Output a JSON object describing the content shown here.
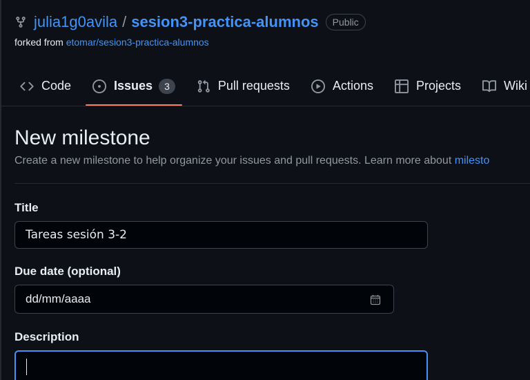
{
  "repo": {
    "owner": "julia1g0avila",
    "separator": "/",
    "name": "sesion3-practica-alumnos",
    "visibility": "Public",
    "forked_prefix": "forked from",
    "forked_source": "etomar/sesion3-practica-alumnos"
  },
  "tabs": [
    {
      "label": "Code",
      "icon": "code-icon"
    },
    {
      "label": "Issues",
      "icon": "issue-opened-icon",
      "counter": "3",
      "active": true
    },
    {
      "label": "Pull requests",
      "icon": "git-pull-request-icon"
    },
    {
      "label": "Actions",
      "icon": "play-icon"
    },
    {
      "label": "Projects",
      "icon": "table-icon"
    },
    {
      "label": "Wiki",
      "icon": "book-icon"
    }
  ],
  "page": {
    "title": "New milestone",
    "subtitle": "Create a new milestone to help organize your issues and pull requests. Learn more about",
    "subtitle_link": "milesto"
  },
  "form": {
    "title_label": "Title",
    "title_value": "Tareas sesión 3-2",
    "due_label": "Due date (optional)",
    "due_placeholder": "dd/mm/aaaa",
    "description_label": "Description",
    "description_value": ""
  },
  "colors": {
    "background": "#0d1117",
    "link": "#4493f8",
    "active_tab_underline": "#f78166",
    "focus_border": "#4493f8"
  }
}
